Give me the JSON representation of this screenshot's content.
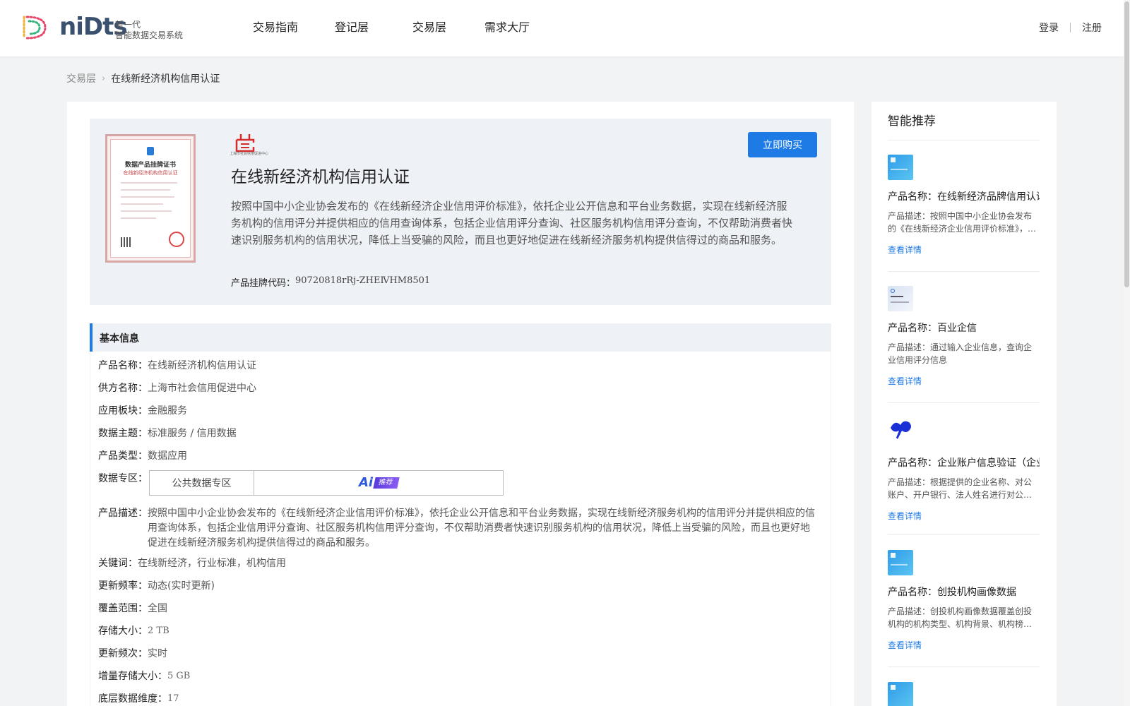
{
  "header": {
    "logo_word": "niDts",
    "logo_sub1": "新一代",
    "logo_sub2": "智能数据交易系统",
    "nav": [
      "交易指南",
      "登记层",
      "交易层",
      "需求大厅"
    ],
    "login": "登录",
    "register": "注册"
  },
  "breadcrumb": {
    "parent": "交易层",
    "current": "在线新经济机构信用认证"
  },
  "hero": {
    "cert_title": "数据产品挂牌证书",
    "cert_sub": "在线新经济机构信用认证",
    "seller_logo_text": "上海市社会信用促进中心",
    "buy_label": "立即购买",
    "title": "在线新经济机构信用认证",
    "desc": "按照中国中小企业协会发布的《在线新经济企业信用评价标准》，依托企业公开信息和平台业务数据，实现在线新经济服务机构的信用评分并提供相应的信用查询体系，包括企业信用评分查询、社区服务机构信用评分查询，不仅帮助消费者快速识别服务机构的信用状况，降低上当受骗的风险，而且也更好地促进在线新经济服务机构提供信得过的商品和服务。",
    "code_label": "产品挂牌代码：",
    "code_value": "90720818rRj-ZHEⅣHM8501"
  },
  "basic": {
    "section_title": "基本信息",
    "rows": [
      {
        "k": "产品名称：",
        "v": "在线新经济机构信用认证"
      },
      {
        "k": "供方名称：",
        "v": "上海市社会信用促进中心"
      },
      {
        "k": "应用板块：",
        "v": "金融服务"
      },
      {
        "k": "数据主题：",
        "v": "标准服务 / 信用数据"
      },
      {
        "k": "产品类型：",
        "v": "数据应用"
      }
    ],
    "zone_label": "数据专区：",
    "zone_name": "公共数据专区",
    "ai_text": "Ai",
    "ai_tag": "推荐",
    "desc_label": "产品描述：",
    "desc_value": "按照中国中小企业协会发布的《在线新经济企业信用评价标准》，依托企业公开信息和平台业务数据，实现在线新经济服务机构的信用评分并提供相应的信用查询体系，包括企业信用评分查询、社区服务机构信用评分查询，不仅帮助消费者快速识别服务机构的信用状况，降低上当受骗的风险，而且也更好地促进在线新经济服务机构提供信得过的商品和服务。",
    "rows2": [
      {
        "k": "关键词：",
        "v": "在线新经济，行业标准，机构信用"
      },
      {
        "k": "更新频率：",
        "v": "动态(实时更新)"
      },
      {
        "k": "覆盖范围：",
        "v": "全国"
      },
      {
        "k": "存储大小：",
        "v": "2 TB"
      },
      {
        "k": "更新频次：",
        "v": "实时"
      },
      {
        "k": "增量存储大小：",
        "v": "5 GB"
      },
      {
        "k": "底层数据维度：",
        "v": "17"
      }
    ]
  },
  "sidebar": {
    "title": "智能推荐",
    "link_label": "查看详情",
    "items": [
      {
        "name": "产品名称：在线新经济品牌信用认证",
        "desc": "产品描述：按照中国中小企业协会发布的《在线新经济企业信用评价标准》，依托企业公开信息和平台业务数据",
        "thumb": "doc-thumb-icon"
      },
      {
        "name": "产品名称：百业企信",
        "desc": "产品描述：通过输入企业信息，查询企业信用评分信息",
        "thumb": "doc-thumb-icon"
      },
      {
        "name": "产品名称：企业账户信息验证（企业",
        "desc": "产品描述：根据提供的企业名称、对公账户、开户银行、法人姓名进行对公账户信息验证",
        "thumb": "ginkgo-leaf-icon"
      },
      {
        "name": "产品名称：创投机构画像数据",
        "desc": "产品描述：创投机构画像数据覆盖创投机构的机构类型、机构背景、机构榜单等信息",
        "thumb": "doc-thumb-icon"
      }
    ]
  },
  "colors": {
    "accent": "#1e7ae5",
    "ai_purple": "#6b46e0"
  }
}
